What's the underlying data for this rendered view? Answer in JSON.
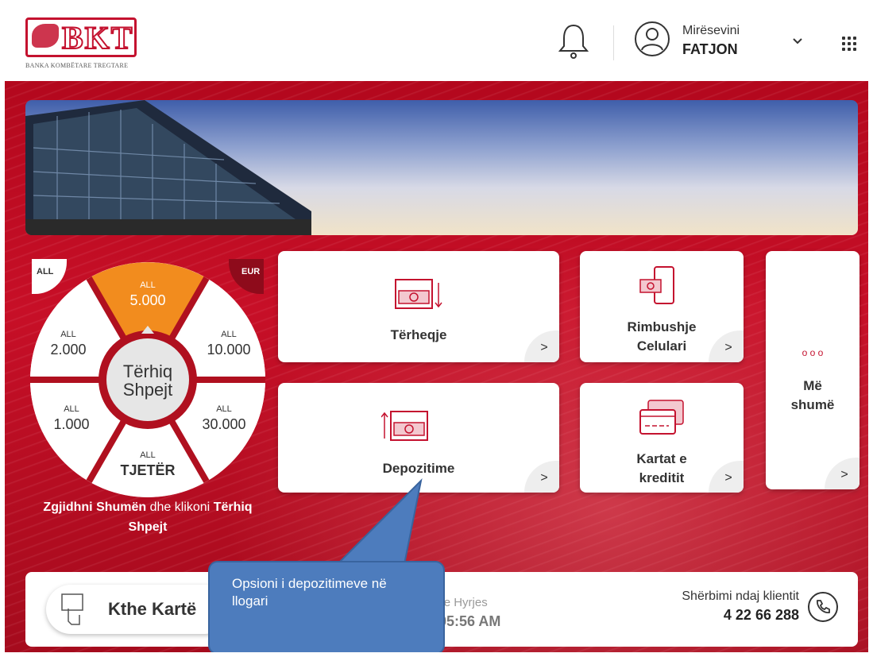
{
  "header": {
    "logo_text": "BKT",
    "logo_subtitle": "BANKA KOMBËTARE TREGTARE",
    "welcome": "Mirësevini",
    "username": "FATJON"
  },
  "quick_withdraw": {
    "left_tag": "ALL",
    "right_tag": "EUR",
    "center_line1": "Tërhiq",
    "center_line2": "Shpejt",
    "segments": [
      {
        "currency": "ALL",
        "amount": "5.000"
      },
      {
        "currency": "ALL",
        "amount": "10.000"
      },
      {
        "currency": "ALL",
        "amount": "30.000"
      },
      {
        "currency": "ALL",
        "amount": "TJETËR"
      },
      {
        "currency": "ALL",
        "amount": "1.000"
      },
      {
        "currency": "ALL",
        "amount": "2.000"
      }
    ],
    "caption_bold1": "Zgjidhni Shumën",
    "caption_mid": " dhe klikoni ",
    "caption_bold2": "Tërhiq",
    "caption_line2": "Shpejt"
  },
  "tiles": {
    "withdraw": "Tërheqje",
    "mobile_line1": "Rimbushje",
    "mobile_line2": "Celulari",
    "deposit": "Depozitime",
    "cards_line1": "Kartat e",
    "cards_line2": "kreditit",
    "more_line1": "Më",
    "more_line2": "shumë",
    "more_dots": "o o o",
    "arrow": ">"
  },
  "bottom": {
    "return_card": "Kthe Kartë",
    "last_login_label": "undit e Hyrjes",
    "last_login_value": "21, 05:56 AM",
    "service_label": "Shërbimi ndaj klientit",
    "service_number": "4 22 66 288"
  },
  "callout": {
    "text": "Opsioni i depozitimeve në llogari"
  },
  "colors": {
    "brand_red": "#c4122f",
    "selected_orange": "#f28c1e",
    "callout_blue": "#4d7cbd"
  }
}
